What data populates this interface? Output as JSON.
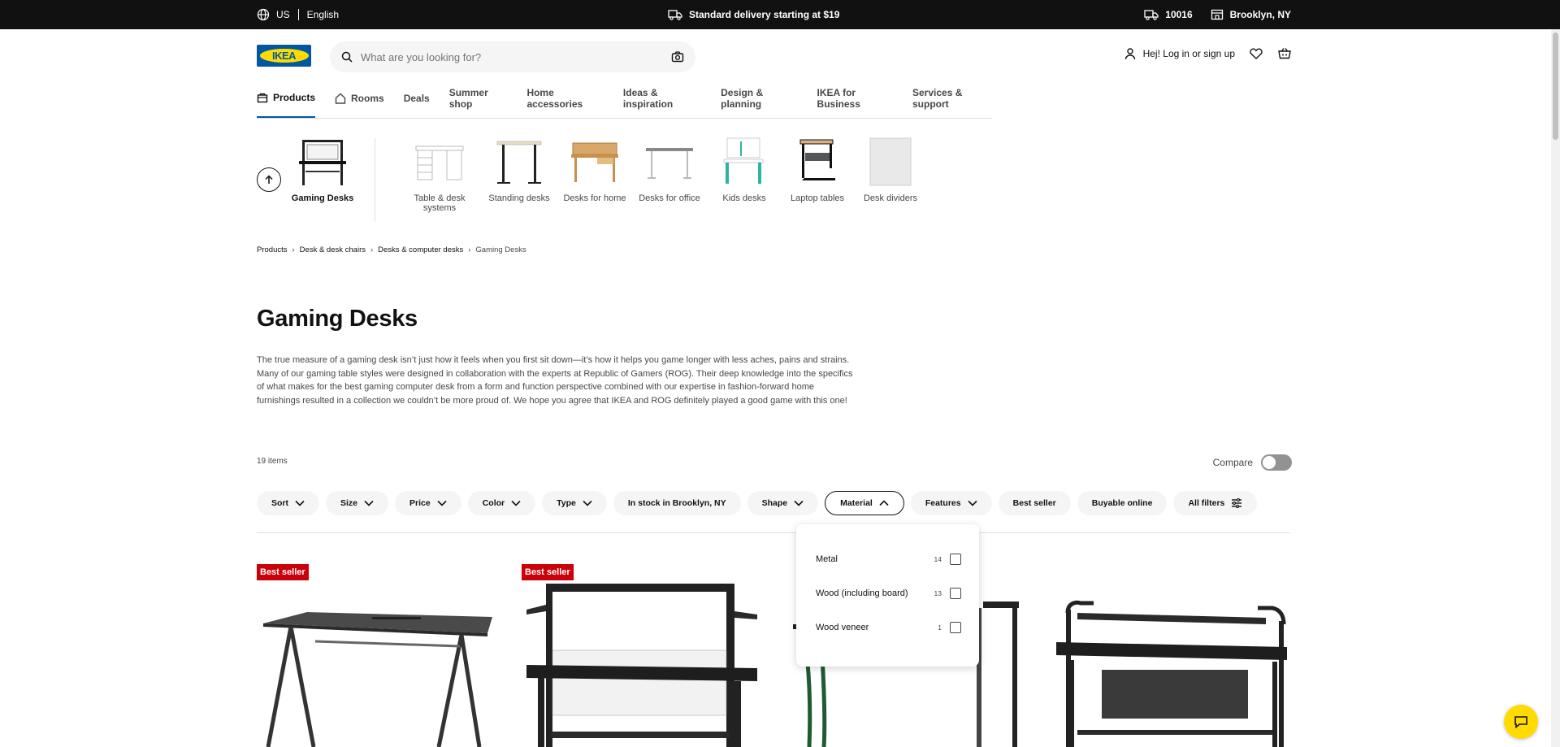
{
  "topbar": {
    "country": "US",
    "language": "English",
    "delivery": "Standard delivery starting at $19",
    "zip": "10016",
    "store": "Brooklyn, NY"
  },
  "header": {
    "logo_text": "IKEA",
    "search_placeholder": "What are you looking for?",
    "login": "Hej! Log in or sign up"
  },
  "nav": {
    "items": [
      "Products",
      "Rooms",
      "Deals",
      "Summer shop",
      "Home accessories",
      "Ideas & inspiration",
      "Design & planning",
      "IKEA for Business",
      "Services & support"
    ]
  },
  "categories": {
    "current": "Gaming Desks",
    "items": [
      "Table & desk systems",
      "Standing desks",
      "Desks for home",
      "Desks for office",
      "Kids desks",
      "Laptop tables",
      "Desk dividers"
    ]
  },
  "breadcrumb": [
    "Products",
    "Desk & desk chairs",
    "Desks & computer desks",
    "Gaming Desks"
  ],
  "page": {
    "title": "Gaming Desks",
    "description": "The true measure of a gaming desk isn’t just how it feels when you first sit down—it’s how it helps you game longer with less aches, pains and strains. Many of our gaming table styles were designed in collaboration with the experts at Republic of Gamers (ROG). Their deep knowledge into the specifics of what makes for the best gaming computer desk from a form and function perspective combined with our expertise in fashion-forward home furnishings resulted in a collection we couldn’t be more proud of. We hope you agree that IKEA and ROG definitely played a good game with this one!",
    "item_count": "19 items",
    "compare_label": "Compare"
  },
  "filters": [
    "Sort",
    "Size",
    "Price",
    "Color",
    "Type",
    "In stock in Brooklyn, NY",
    "Shape",
    "Material",
    "Features",
    "Best seller",
    "Buyable online",
    "All filters"
  ],
  "material_dropdown": [
    {
      "label": "Metal",
      "count": "14"
    },
    {
      "label": "Wood (including board)",
      "count": "13"
    },
    {
      "label": "Wood veneer",
      "count": "1"
    }
  ],
  "products": {
    "badge": "Best seller"
  },
  "colors": {
    "ikea_blue": "#0058a3",
    "ikea_yellow": "#ffdb00",
    "badge_red": "#cc0008"
  }
}
